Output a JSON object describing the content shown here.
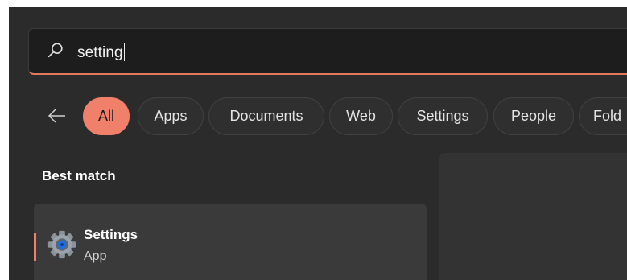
{
  "search": {
    "value": "setting",
    "icon": "search-icon"
  },
  "filters": {
    "back_icon": "back-arrow-icon",
    "chips": [
      {
        "label": "All",
        "active": true
      },
      {
        "label": "Apps"
      },
      {
        "label": "Documents"
      },
      {
        "label": "Web"
      },
      {
        "label": "Settings"
      },
      {
        "label": "People"
      },
      {
        "label": "Fold"
      }
    ]
  },
  "results": {
    "section_title": "Best match",
    "best_match": {
      "title": "Settings",
      "subtitle": "App",
      "icon": "settings-gear-icon"
    }
  },
  "colors": {
    "accent": "#f0806a",
    "background": "#2b2b2b",
    "search_background": "#1d1d1d"
  }
}
